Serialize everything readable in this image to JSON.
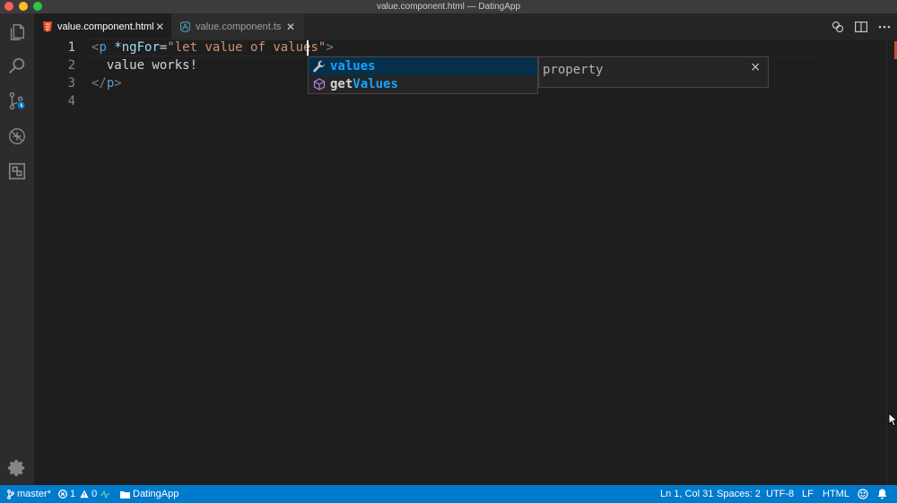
{
  "window": {
    "title": "value.component.html — DatingApp"
  },
  "activity_bar": {
    "items": [
      "files-icon",
      "search-icon",
      "source-control-icon",
      "debug-icon",
      "extensions-icon"
    ],
    "bottom": "gear-icon"
  },
  "tabs": [
    {
      "label": "value.component.html",
      "icon": "html-file-icon",
      "active": true,
      "close": "✕"
    },
    {
      "label": "value.component.ts",
      "icon": "angular-file-icon",
      "active": false,
      "close": "✕"
    }
  ],
  "editor": {
    "line_numbers": [
      "1",
      "2",
      "3",
      "4"
    ],
    "lines": {
      "l1": {
        "open": "<",
        "tag": "p",
        "space": " ",
        "attr": "*ngFor",
        "eq": "=",
        "str": "\"let value of values\"",
        "close": ">"
      },
      "l2": {
        "text": "  value works!"
      },
      "l3": {
        "open": "</",
        "tag": "p",
        "close": ">"
      }
    }
  },
  "suggest": {
    "items": [
      {
        "icon": "wrench-icon",
        "prefix": "",
        "match": "values",
        "suffix": "",
        "selected": true
      },
      {
        "icon": "method-cube-icon",
        "prefix": "get",
        "match": "Values",
        "suffix": "",
        "selected": false
      }
    ],
    "details": {
      "text": "property",
      "close": "×"
    }
  },
  "statusbar": {
    "branch": "master*",
    "errors": "1",
    "warnings": "0",
    "folder": "DatingApp",
    "position": "Ln 1, Col 31",
    "spaces": "Spaces: 2",
    "encoding": "UTF-8",
    "eol": "LF",
    "language": "HTML"
  },
  "colors": {
    "accent": "#007acc",
    "suggest_highlight": "#18a3ff",
    "selected_row": "#062f4a"
  }
}
